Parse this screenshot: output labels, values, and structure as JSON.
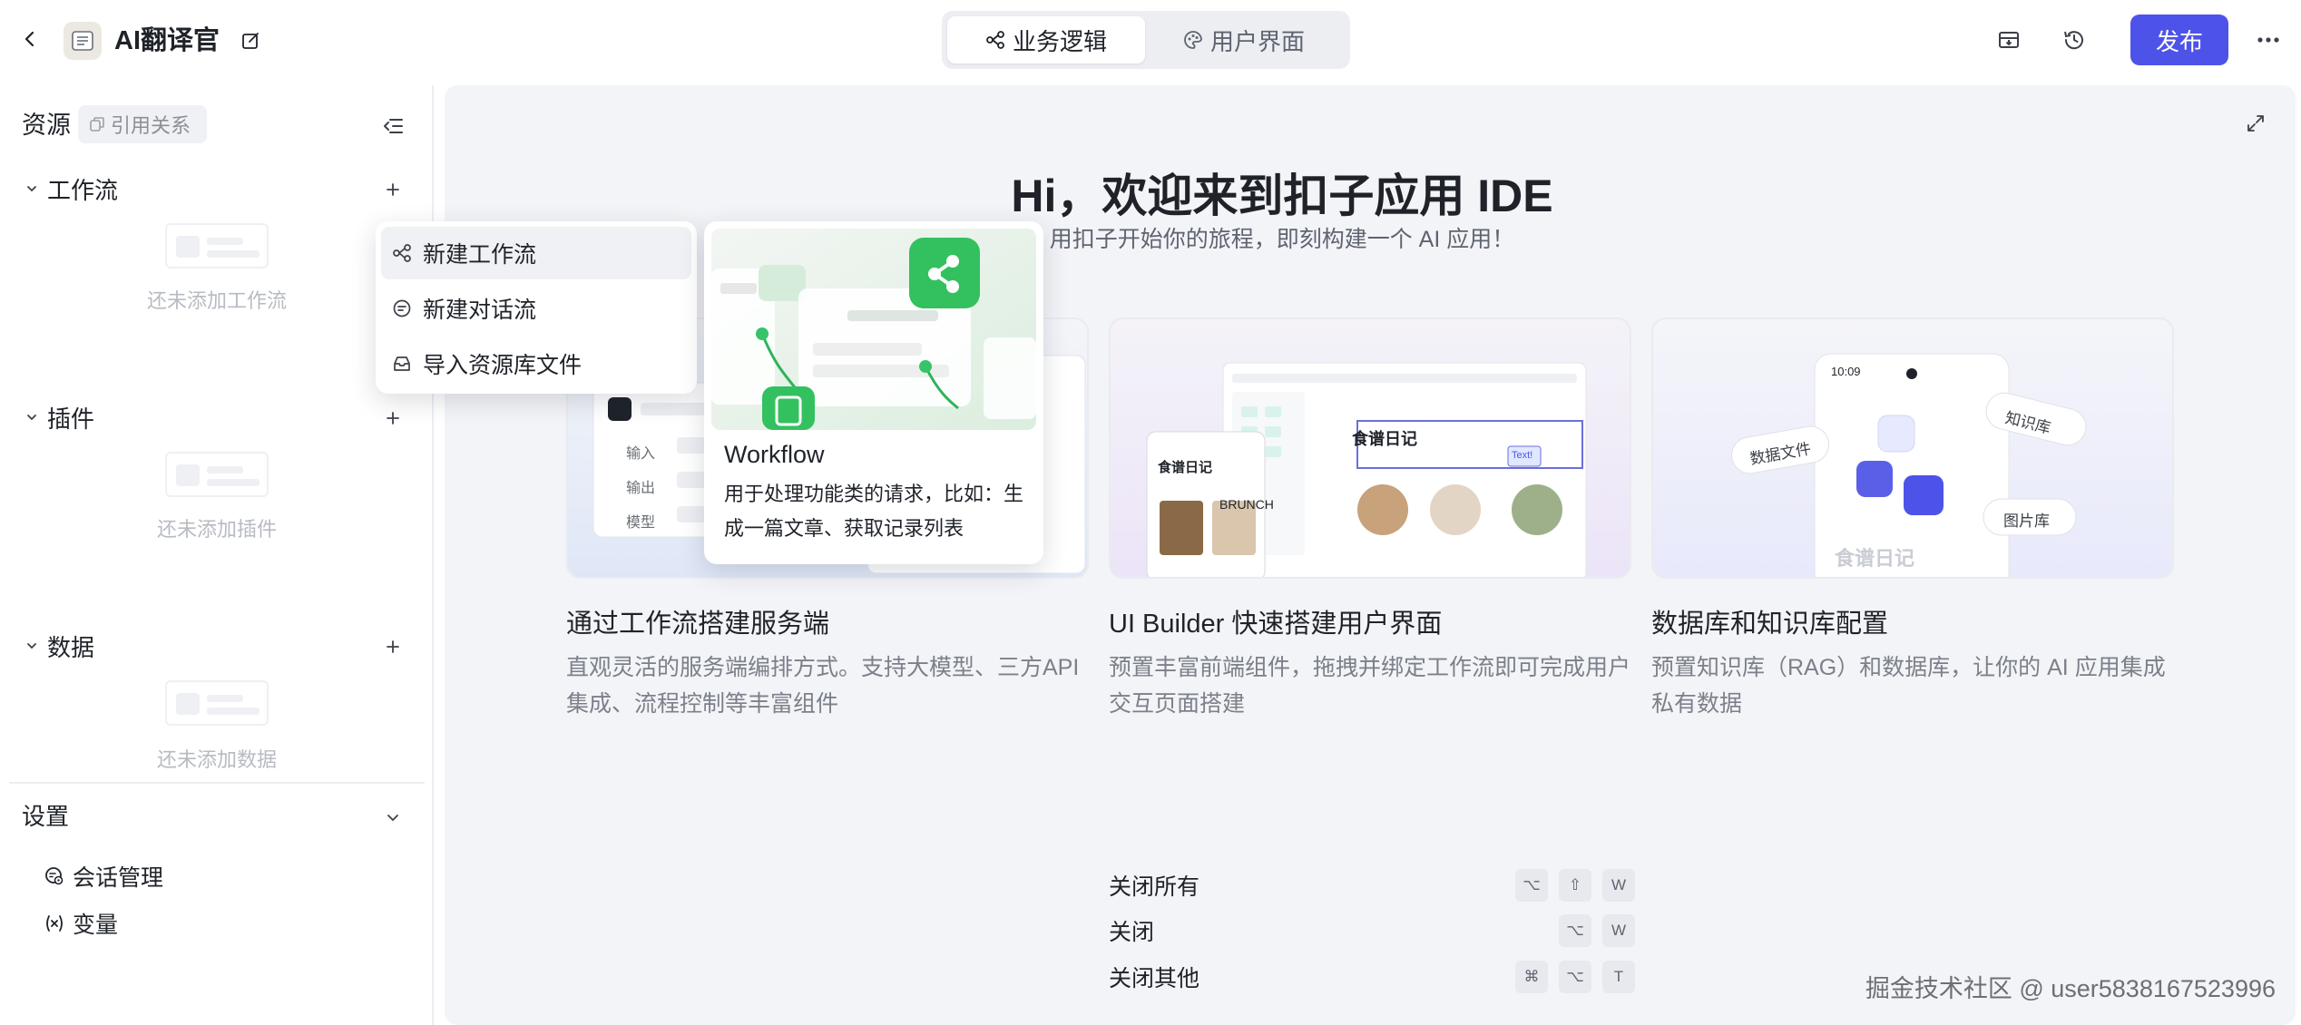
{
  "topbar": {
    "app_title": "AI翻译官",
    "tabs": [
      {
        "label": "业务逻辑",
        "icon": "workflow-icon",
        "active": true
      },
      {
        "label": "用户界面",
        "icon": "palette-icon",
        "active": false
      }
    ],
    "publish_label": "发布"
  },
  "sidebar": {
    "title": "资源",
    "ref_chip": "引用关系",
    "sections": [
      {
        "title": "工作流",
        "empty_text": "还未添加工作流"
      },
      {
        "title": "插件",
        "empty_text": "还未添加插件"
      },
      {
        "title": "数据",
        "empty_text": "还未添加数据"
      }
    ],
    "settings": {
      "title": "设置",
      "items": [
        {
          "label": "会话管理",
          "icon": "chat-settings-icon"
        },
        {
          "label": "变量",
          "icon": "variable-icon"
        }
      ]
    }
  },
  "main": {
    "hero_title": "Hi，欢迎来到扣子应用 IDE",
    "hero_subtitle": "用扣子开始你的旅程，即刻构建一个 AI 应用！",
    "cards": [
      {
        "title": "通过工作流搭建服务端",
        "desc": "直观灵活的服务端编排方式。支持大模型、三方API集成、流程控制等丰富组件",
        "img": {
          "labels": [
            "输入",
            "输出",
            "模型"
          ]
        }
      },
      {
        "title": "UI Builder 快速搭建用户界面",
        "desc": "预置丰富前端组件，拖拽并绑定工作流即可完成用户交互页面搭建",
        "img": {
          "heading": "食谱日记",
          "heading2": "食谱日记",
          "tag": "Text!",
          "word": "BRUNCH"
        }
      },
      {
        "title": "数据库和知识库配置",
        "desc": "预置知识库（RAG）和数据库，让你的 AI 应用集成私有数据",
        "img": {
          "time": "10:09",
          "chip_left": "数据文件",
          "chip_right": "知识库",
          "chip_bottom": "图片库",
          "footer": "食谱日记"
        }
      }
    ],
    "shortcuts": [
      {
        "label": "关闭所有",
        "keys": [
          "⌥",
          "⇧",
          "W"
        ]
      },
      {
        "label": "关闭",
        "keys": [
          "⌥",
          "W"
        ]
      },
      {
        "label": "关闭其他",
        "keys": [
          "⌘",
          "⌥",
          "T"
        ]
      }
    ],
    "watermark": "掘金技术社区 @ user5838167523996"
  },
  "dropdown": {
    "items": [
      {
        "label": "新建工作流",
        "icon": "workflow-icon"
      },
      {
        "label": "新建对话流",
        "icon": "chat-flow-icon"
      },
      {
        "label": "导入资源库文件",
        "icon": "import-icon"
      }
    ]
  },
  "preview": {
    "title": "Workflow",
    "desc": "用于处理功能类的请求，比如：生成一篇文章、获取记录列表"
  },
  "colors": {
    "accent": "#4d53e8",
    "canvas": "#f3f4f7",
    "green": "#35c46a"
  }
}
